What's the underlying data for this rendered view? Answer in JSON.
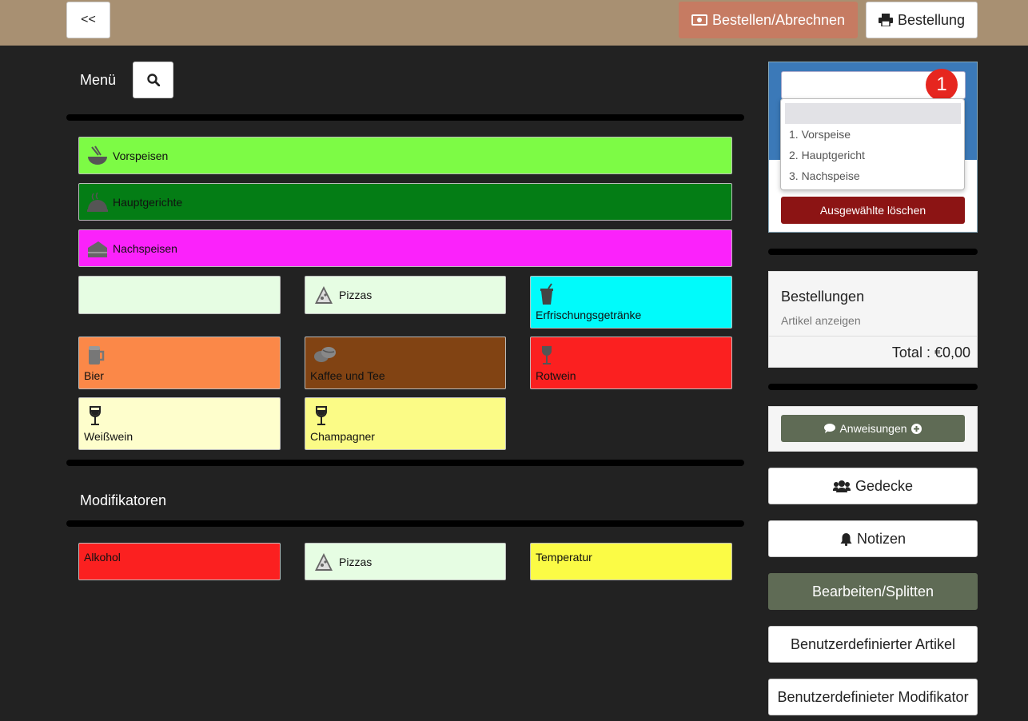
{
  "topbar": {
    "back_label": "<<",
    "checkout_label": "Bestellen/Abrechnen",
    "order_label": "Bestellung"
  },
  "menu": {
    "title": "Menü",
    "wide_categories": [
      {
        "label": "Vorspeisen",
        "color": "#7dfb45",
        "icon": "noodle-bowl-icon"
      },
      {
        "label": "Hauptgerichte",
        "color": "#047d15",
        "icon": "cloche-icon"
      },
      {
        "label": "Nachspeisen",
        "color": "#fb22fb",
        "icon": "cake-icon"
      }
    ],
    "grid_categories": [
      {
        "label": "",
        "color": "#e6fde3",
        "icon": ""
      },
      {
        "label": "Pizzas",
        "color": "#e6fde3",
        "icon": "pizza-icon"
      },
      {
        "label": "Erfrischungsgetränke",
        "color": "#00fbfb",
        "icon": "soft-drink-icon"
      },
      {
        "label": "Bier",
        "color": "#fb8848",
        "icon": "beer-icon"
      },
      {
        "label": "Kaffee und Tee",
        "color": "#814313",
        "icon": "coffee-bean-icon"
      },
      {
        "label": "Rotwein",
        "color": "#fb2020",
        "icon": "wine-glass-icon"
      },
      {
        "label": "Weißwein",
        "color": "#fefecc",
        "icon": "wine-glass-icon"
      },
      {
        "label": "Champagner",
        "color": "#fbfb86",
        "icon": "wine-glass-icon"
      }
    ]
  },
  "modifiers": {
    "title": "Modifikatoren",
    "items": [
      {
        "label": "Alkohol",
        "color": "#fb2020",
        "icon": ""
      },
      {
        "label": "Pizzas",
        "color": "#e6fde3",
        "icon": "pizza-icon"
      },
      {
        "label": "Temperatur",
        "color": "#fbfb45",
        "icon": ""
      }
    ]
  },
  "course": {
    "badge": "1",
    "options": [
      "1. Vorspeise",
      "2. Hauptgericht",
      "3. Nachspeise"
    ],
    "delete_label": "Ausgewählte löschen"
  },
  "orders": {
    "title": "Bestellungen",
    "show_items": "Artikel anzeigen",
    "total": "Total : €0,00"
  },
  "actions": {
    "instructions": "Anweisungen",
    "covers": "Gedecke",
    "notes": "Notizen",
    "edit_split": "Bearbeiten/Splitten",
    "custom_item": "Benutzerdefinierter Artikel",
    "custom_modifier": "Benutzerdefinieter Modifikator"
  },
  "colors": {
    "topbar": "#a89072",
    "checkout": "#c67b62",
    "course_header": "#3b79b8",
    "delete": "#8c1414",
    "olive_button": "#5f6b55"
  }
}
